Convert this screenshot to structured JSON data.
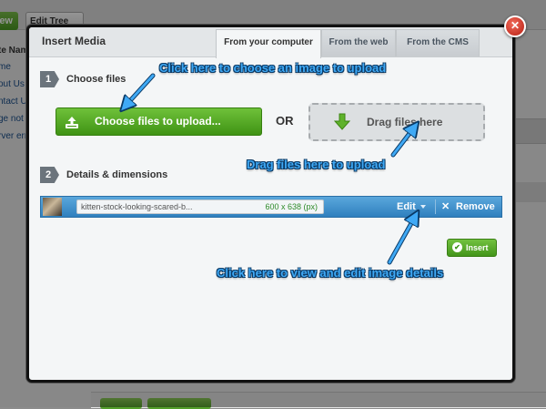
{
  "background": {
    "new_label": "ew",
    "edit_tree_label": "Edit Tree",
    "left_items": [
      "te Nam",
      "me",
      "out Us",
      "ntact U",
      "ge not f",
      "rver err"
    ]
  },
  "modal": {
    "title": "Insert Media",
    "tabs": [
      {
        "label": "From your computer",
        "active": true
      },
      {
        "label": "From the web",
        "active": false
      },
      {
        "label": "From the CMS",
        "active": false
      }
    ],
    "close_glyph": "✕",
    "step1": {
      "number": "1",
      "label": "Choose files"
    },
    "choose_button_label": "Choose files to upload...",
    "or_label": "OR",
    "drag_label": "Drag files here",
    "step2": {
      "number": "2",
      "label": "Details & dimensions"
    },
    "file": {
      "name": "kitten-stock-looking-scared-b...",
      "dimensions": "600 x 638 (px)",
      "edit_label": "Edit",
      "remove_glyph": "✕",
      "remove_label": "Remove"
    },
    "insert_label": "Insert"
  },
  "annotations": {
    "choose": "Click here to choose an image to upload",
    "drag": "Drag files here to upload",
    "edit": "Click here to view and edit image details"
  },
  "colors": {
    "accent_blue": "#3fa9f5",
    "primary_green": "#4ea626",
    "file_row_blue": "#3a8bc8",
    "close_red": "#d23a2c"
  },
  "icons": [
    "close-icon",
    "upload-icon",
    "drag-down-arrow-icon",
    "chevron-down-icon",
    "remove-x-icon",
    "check-circle-icon"
  ]
}
